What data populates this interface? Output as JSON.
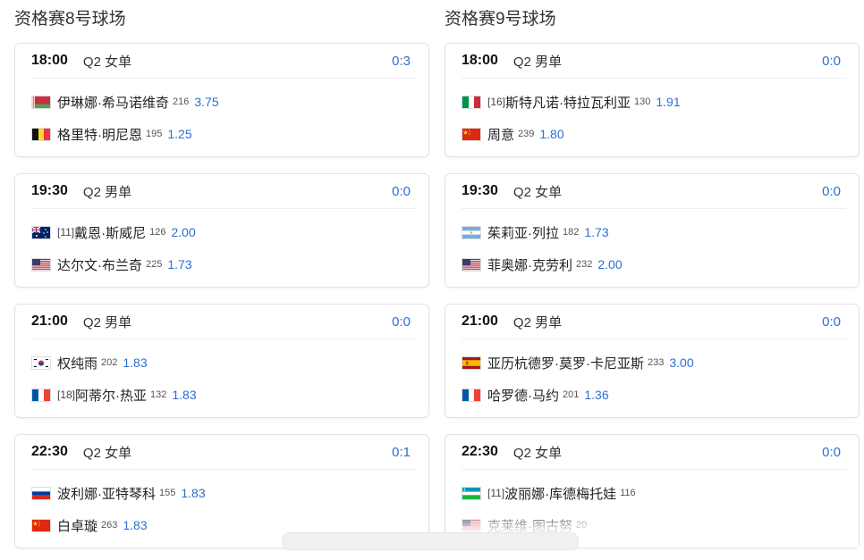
{
  "courts": [
    {
      "title": "资格赛8号球场",
      "matches": [
        {
          "time": "18:00",
          "round": "Q2 女单",
          "score": "0:3",
          "players": [
            {
              "flag": "by",
              "flag_icon": "belarus-flag-icon",
              "seed": "",
              "name": "伊琳娜·希马诺维奇",
              "rank": "216",
              "odds": "3.75"
            },
            {
              "flag": "be",
              "flag_icon": "belgium-flag-icon",
              "seed": "",
              "name": "格里特·明尼恩",
              "rank": "195",
              "odds": "1.25"
            }
          ]
        },
        {
          "time": "19:30",
          "round": "Q2 男单",
          "score": "0:0",
          "players": [
            {
              "flag": "au",
              "flag_icon": "australia-flag-icon",
              "seed": "[11]",
              "name": "戴恩·斯威尼",
              "rank": "126",
              "odds": "2.00"
            },
            {
              "flag": "us",
              "flag_icon": "usa-flag-icon",
              "seed": "",
              "name": "达尔文·布兰奇",
              "rank": "225",
              "odds": "1.73"
            }
          ]
        },
        {
          "time": "21:00",
          "round": "Q2 男单",
          "score": "0:0",
          "players": [
            {
              "flag": "kr",
              "flag_icon": "south-korea-flag-icon",
              "seed": "",
              "name": "权纯雨",
              "rank": "202",
              "odds": "1.83"
            },
            {
              "flag": "fr",
              "flag_icon": "france-flag-icon",
              "seed": "[18]",
              "name": "阿蒂尔·热亚",
              "rank": "132",
              "odds": "1.83"
            }
          ]
        },
        {
          "time": "22:30",
          "round": "Q2 女单",
          "score": "0:1",
          "players": [
            {
              "flag": "ru",
              "flag_icon": "russia-flag-icon",
              "seed": "",
              "name": "波利娜·亚特琴科",
              "rank": "155",
              "odds": "1.83"
            },
            {
              "flag": "cn",
              "flag_icon": "china-flag-icon",
              "seed": "",
              "name": "白卓璇",
              "rank": "263",
              "odds": "1.83"
            }
          ]
        }
      ]
    },
    {
      "title": "资格赛9号球场",
      "matches": [
        {
          "time": "18:00",
          "round": "Q2 男单",
          "score": "0:0",
          "players": [
            {
              "flag": "it",
              "flag_icon": "italy-flag-icon",
              "seed": "[16]",
              "name": "斯特凡诺·特拉瓦利亚",
              "rank": "130",
              "odds": "1.91"
            },
            {
              "flag": "cn",
              "flag_icon": "china-flag-icon",
              "seed": "",
              "name": "周意",
              "rank": "239",
              "odds": "1.80"
            }
          ]
        },
        {
          "time": "19:30",
          "round": "Q2 女单",
          "score": "0:0",
          "players": [
            {
              "flag": "ar",
              "flag_icon": "argentina-flag-icon",
              "seed": "",
              "name": "茱莉亚·列拉",
              "rank": "182",
              "odds": "1.73"
            },
            {
              "flag": "us",
              "flag_icon": "usa-flag-icon",
              "seed": "",
              "name": "菲奥娜·克劳利",
              "rank": "232",
              "odds": "2.00"
            }
          ]
        },
        {
          "time": "21:00",
          "round": "Q2 男单",
          "score": "0:0",
          "players": [
            {
              "flag": "es",
              "flag_icon": "spain-flag-icon",
              "seed": "",
              "name": "亚历杭德罗·莫罗·卡尼亚斯",
              "rank": "233",
              "odds": "3.00"
            },
            {
              "flag": "fr",
              "flag_icon": "france-flag-icon",
              "seed": "",
              "name": "哈罗德·马约",
              "rank": "201",
              "odds": "1.36"
            }
          ]
        },
        {
          "time": "22:30",
          "round": "Q2 女单",
          "score": "0:0",
          "players": [
            {
              "flag": "uz",
              "flag_icon": "uzbekistan-flag-icon",
              "seed": "[11]",
              "name": "波丽娜·库德梅托娃",
              "rank": "116",
              "odds": ""
            },
            {
              "flag": "us",
              "flag_icon": "usa-flag-icon",
              "seed": "",
              "name": "克莱维·图古努",
              "rank": "20",
              "odds": ""
            }
          ]
        }
      ]
    }
  ],
  "colors": {
    "accent": "#2c6fd2",
    "border": "#e3e3e3"
  }
}
